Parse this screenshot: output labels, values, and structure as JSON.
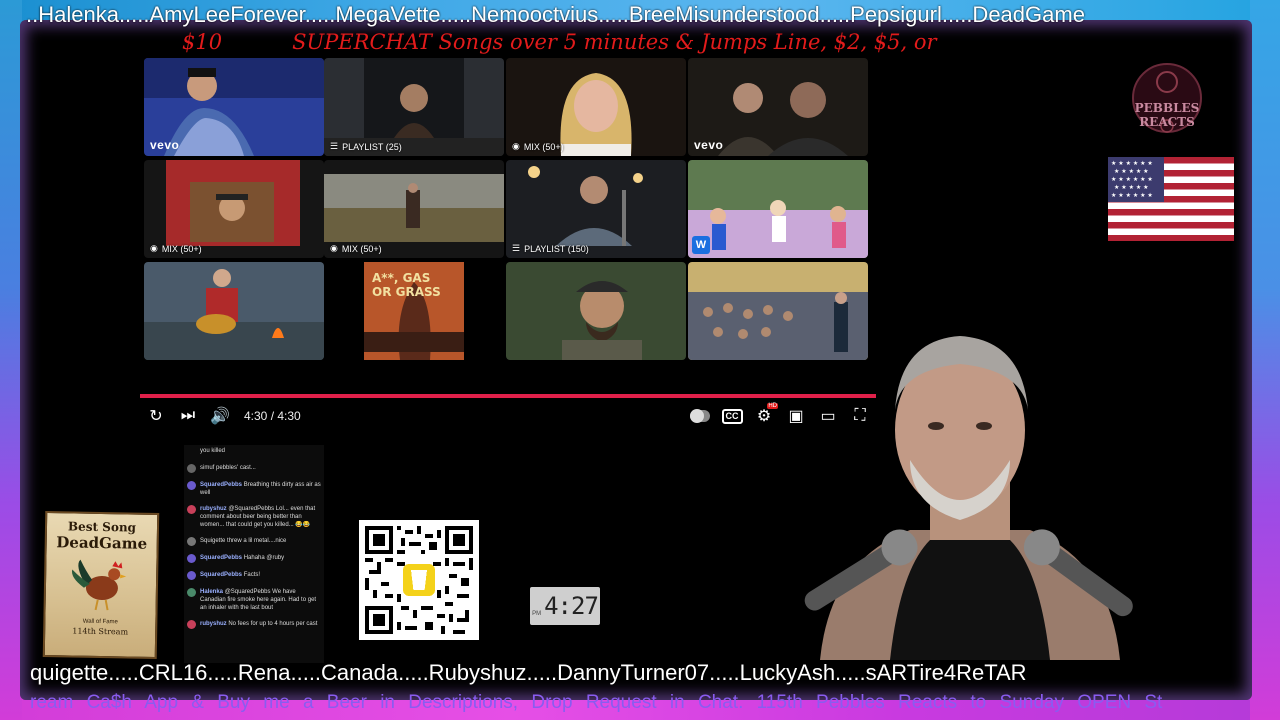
{
  "ticker_top": "..Halenka.....AmyLeeForever.....MegaVette.....Nemooctvius.....BreeMisunderstood.....Pepsigurl.....DeadGame",
  "superchat": {
    "amount": "$10",
    "text": "SUPERCHAT Songs over 5 minutes & Jumps Line, $2, $5, or"
  },
  "player": {
    "tiles": [
      {
        "label": "",
        "vevo": "vevo"
      },
      {
        "label": "PLAYLIST (25)"
      },
      {
        "label": "MIX (50+)"
      },
      {
        "label": "",
        "vevo": "vevo"
      },
      {
        "label": "MIX (50+)"
      },
      {
        "label": "MIX (50+)"
      },
      {
        "label": "PLAYLIST (150)"
      },
      {
        "label": ""
      },
      {
        "label": ""
      },
      {
        "label": "",
        "art_title": "A**, GAS OR GRASS"
      },
      {
        "label": ""
      },
      {
        "label": ""
      }
    ],
    "time": "4:30 / 4:30",
    "progress": 1.0,
    "colors": {
      "progress": "#e0204a"
    }
  },
  "chat": [
    {
      "name": "",
      "text": "you killed"
    },
    {
      "name": "",
      "text": "simuf pebbles' cast..."
    },
    {
      "name": "SquaredPebbs",
      "text": "Breathing this dirty ass air as well"
    },
    {
      "name": "rubyshuz",
      "text": "@SquaredPebbs Lol... even that comment about beer being better than women... that could get you killed... 😂😂"
    },
    {
      "name": "",
      "text": "Squigette threw a lil metal....nice"
    },
    {
      "name": "SquaredPebbs",
      "text": "Hahaha @ruby"
    },
    {
      "name": "SquaredPebbs",
      "text": "Facts!"
    },
    {
      "name": "Halenka",
      "text": "@SquaredPebbs We have Canadian fire smoke here again. Had to get an inhaler with the last bout"
    },
    {
      "name": "rubyshuz",
      "text": "No fees for up to 4 hours per cast"
    }
  ],
  "poster": {
    "line1": "Best Song",
    "line2": "DeadGame",
    "line3": "Wall of Fame",
    "line4": "114th Stream"
  },
  "clock": {
    "digits": "4:27",
    "ampm": "PM"
  },
  "logo": {
    "text": "PEBBLES REACTS"
  },
  "ticker_bottom": "quigette.....CRL16.....Rena.....Canada.....Rubyshuz.....DannyTurner07.....LuckyAsh.....sARTire4ReTAR",
  "ticker_promo": "ream     Ca$h App & Buy me a Beer in Descriptions,     Drop Request in Chat.     115th Pebbles Reacts to Sunday OPEN St",
  "icons": [
    "replay-icon",
    "next-icon",
    "volume-icon",
    "autoplay-toggle",
    "captions-icon",
    "settings-icon",
    "miniplayer-icon",
    "theater-icon",
    "fullscreen-icon",
    "playlist-icon",
    "mix-icon"
  ]
}
